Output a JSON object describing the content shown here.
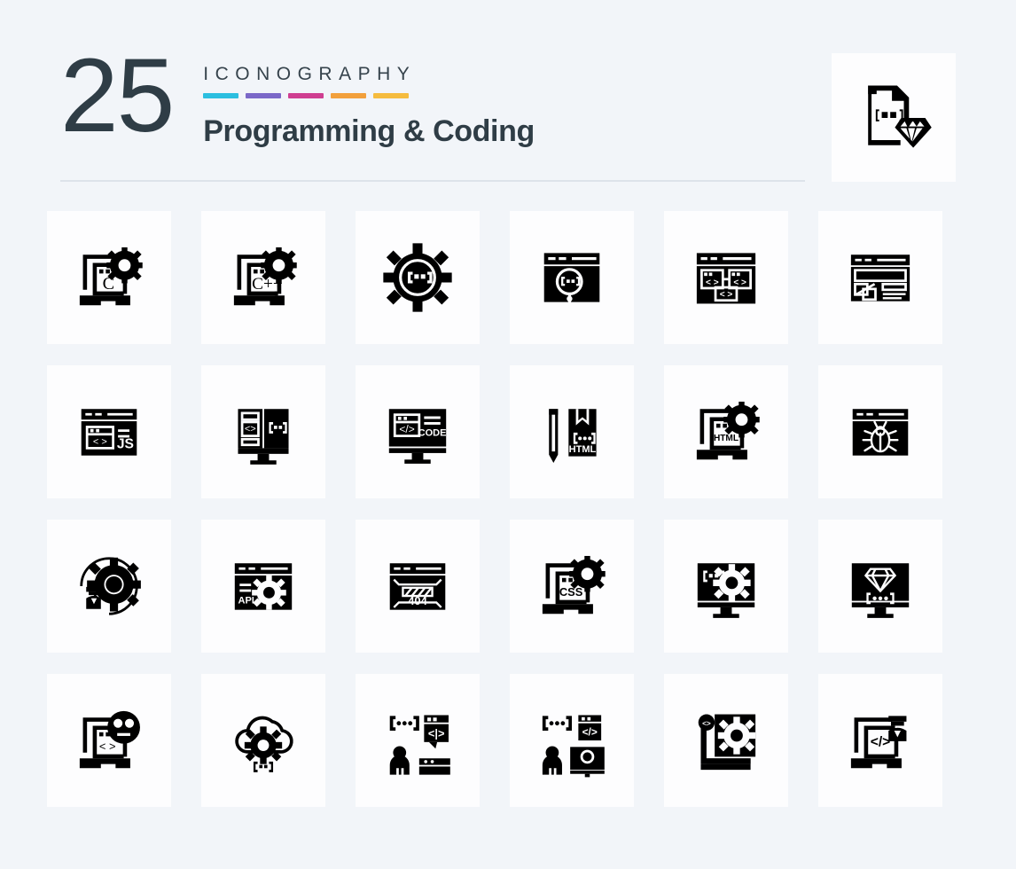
{
  "header": {
    "count": "25",
    "kicker": "ICONOGRAPHY",
    "subtitle": "Programming & Coding",
    "dash_colors": [
      "#2cbfe0",
      "#7b68c8",
      "#cf3e91",
      "#f2a03c",
      "#f5bc3f"
    ],
    "text_color": "#2f3d46",
    "divider_color": "#dde3ea"
  },
  "theme": {
    "page_background": "#f2f5f9",
    "card_background": "#fdfdfe",
    "icon_color": "#000000"
  },
  "featured": {
    "name": "ruby-code-file-icon",
    "label": "Ruby code file",
    "code_text": "{■■}"
  },
  "grid": {
    "columns": 6,
    "rows": 4,
    "icons": [
      {
        "name": "c-programming-laptop-icon",
        "label": "C programming on laptop",
        "text": "C"
      },
      {
        "name": "cpp-programming-laptop-icon",
        "label": "C++ programming on laptop",
        "text": "C++"
      },
      {
        "name": "code-settings-gear-icon",
        "label": "Code settings gear",
        "text": "{■■}"
      },
      {
        "name": "code-search-browser-icon",
        "label": "Search code in browser",
        "text": "{■■}"
      },
      {
        "name": "sitemap-code-browser-icon",
        "label": "Code sitemap in browser",
        "text": "< >"
      },
      {
        "name": "web-layout-design-icon",
        "label": "Web layout design",
        "text": ""
      },
      {
        "name": "javascript-browser-icon",
        "label": "JavaScript browser window",
        "text": "JS"
      },
      {
        "name": "responsive-code-monitor-icon",
        "label": "Responsive code monitor",
        "text": "{▪▪}"
      },
      {
        "name": "code-monitor-icon",
        "label": "Code on monitor",
        "text": "CODE"
      },
      {
        "name": "html-document-pen-icon",
        "label": "HTML document with pen",
        "text": "HTML"
      },
      {
        "name": "html-settings-laptop-icon",
        "label": "HTML settings on laptop",
        "text": "HTML"
      },
      {
        "name": "bug-browser-icon",
        "label": "Bug in browser window",
        "text": ""
      },
      {
        "name": "developer-settings-icon",
        "label": "Developer settings",
        "text": ""
      },
      {
        "name": "api-settings-browser-icon",
        "label": "API settings in browser",
        "text": "API"
      },
      {
        "name": "error-404-browser-icon",
        "label": "404 error page",
        "text": "404"
      },
      {
        "name": "css-settings-laptop-icon",
        "label": "CSS settings on laptop",
        "text": "CSS"
      },
      {
        "name": "code-settings-monitor-icon",
        "label": "Code settings on monitor",
        "text": "{▪▪}"
      },
      {
        "name": "ruby-code-monitor-icon",
        "label": "Ruby code on monitor",
        "text": "{ ••• }"
      },
      {
        "name": "user-experience-laptop-icon",
        "label": "User experience on laptop",
        "text": "< >"
      },
      {
        "name": "cloud-computing-settings-icon",
        "label": "Cloud computing settings",
        "text": "{▪▪}"
      },
      {
        "name": "developer-chat-code-icon",
        "label": "Developer code chat",
        "text": "{•••}"
      },
      {
        "name": "developer-monitor-code-icon",
        "label": "Developer with monitor code",
        "text": "{•••}"
      },
      {
        "name": "code-settings-page-icon",
        "label": "Code settings page",
        "text": "< >"
      },
      {
        "name": "developer-coding-laptop-icon",
        "label": "Developer coding on laptop",
        "text": "</>"
      }
    ]
  }
}
